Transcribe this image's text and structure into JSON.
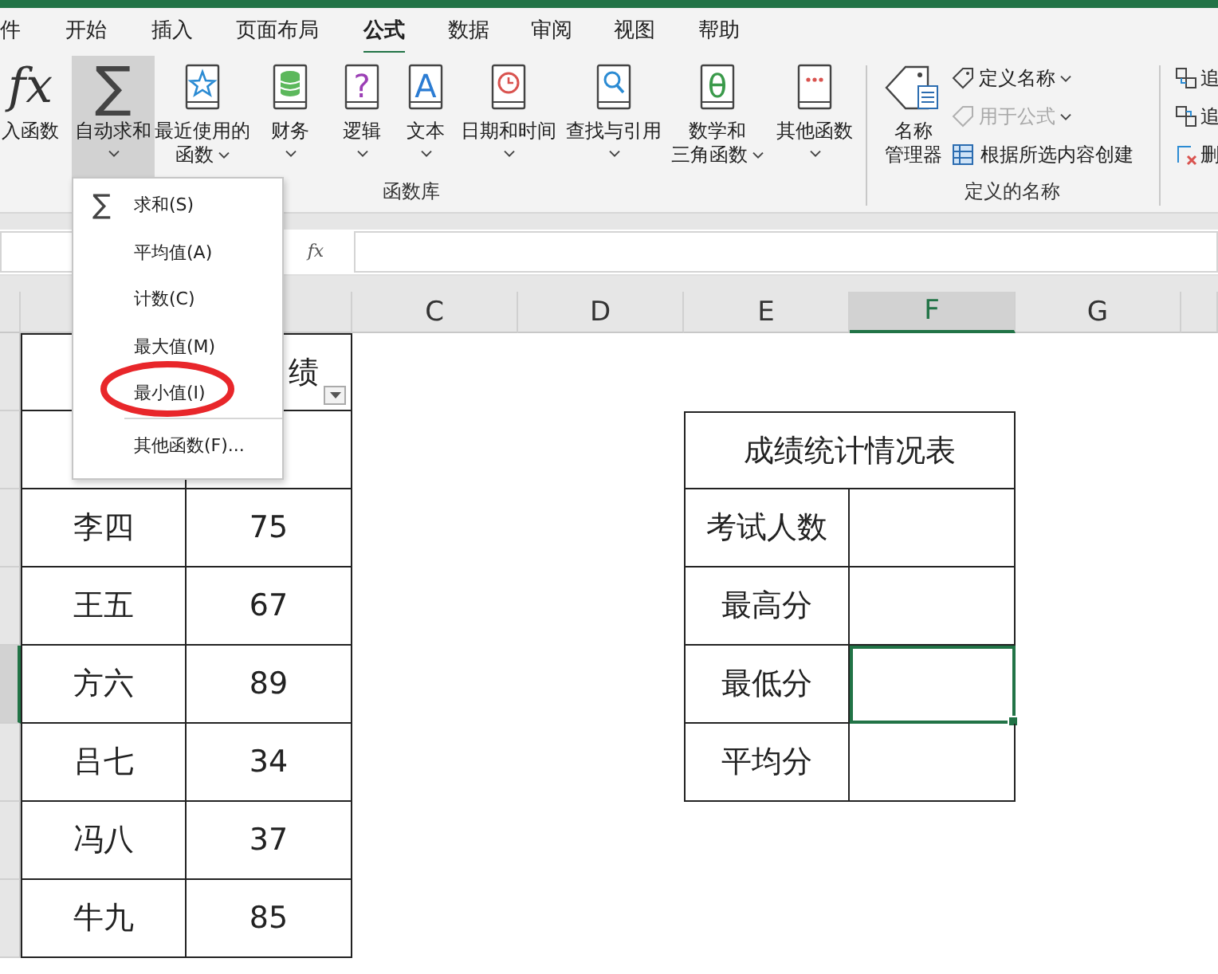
{
  "tabs": [
    {
      "label": "件",
      "selected": false
    },
    {
      "label": "开始",
      "selected": false
    },
    {
      "label": "插入",
      "selected": false
    },
    {
      "label": "页面布局",
      "selected": false
    },
    {
      "label": "公式",
      "selected": true
    },
    {
      "label": "数据",
      "selected": false
    },
    {
      "label": "审阅",
      "selected": false
    },
    {
      "label": "视图",
      "selected": false
    },
    {
      "label": "帮助",
      "selected": false
    }
  ],
  "function_library": {
    "label": "函数库",
    "buttons": [
      {
        "lines": [
          "入函数"
        ],
        "glyph": "fx",
        "dropdown": false,
        "selected": false
      },
      {
        "lines": [
          "自动求和"
        ],
        "glyph": "∑",
        "dropdown": true,
        "selected": true
      },
      {
        "lines": [
          "最近使用的",
          "函数"
        ],
        "dropdown": true,
        "selected": false
      },
      {
        "lines": [
          "财务"
        ],
        "dropdown": true,
        "selected": false
      },
      {
        "lines": [
          "逻辑"
        ],
        "glyph": "?",
        "dropdown": true,
        "selected": false
      },
      {
        "lines": [
          "文本"
        ],
        "glyph": "A",
        "dropdown": true,
        "selected": false
      },
      {
        "lines": [
          "日期和时间"
        ],
        "dropdown": true,
        "selected": false
      },
      {
        "lines": [
          "查找与引用"
        ],
        "dropdown": true,
        "selected": false
      },
      {
        "lines": [
          "数学和",
          "三角函数"
        ],
        "glyph": "θ",
        "dropdown": true,
        "selected": false
      },
      {
        "lines": [
          "其他函数"
        ],
        "dropdown": true,
        "selected": false
      }
    ]
  },
  "defined_names": {
    "label": "定义的名称",
    "manager": {
      "lines": [
        "名称",
        "管理器"
      ]
    },
    "items": [
      {
        "label": "定义名称",
        "dropdown": true,
        "disabled": false
      },
      {
        "label": "用于公式",
        "dropdown": true,
        "disabled": true
      },
      {
        "label": "根据所选内容创建",
        "dropdown": false,
        "disabled": false
      }
    ]
  },
  "formula_auditing": {
    "items": [
      {
        "label": "追"
      },
      {
        "label": "追"
      },
      {
        "label": "删"
      }
    ]
  },
  "autosum_menu": {
    "items": [
      {
        "kind": "item",
        "label": "求和(S)",
        "glyph": "∑"
      },
      {
        "kind": "item",
        "label": "平均值(A)"
      },
      {
        "kind": "item",
        "label": "计数(C)"
      },
      {
        "kind": "item",
        "label": "最大值(M)"
      },
      {
        "kind": "item",
        "label": "最小值(I)"
      },
      {
        "kind": "separator"
      },
      {
        "kind": "item",
        "label": "其他函数(F)..."
      }
    ]
  },
  "formula_bar": {
    "function_label": "fx"
  },
  "sheet": {
    "columns": [
      {
        "label": "C",
        "selected": false
      },
      {
        "label": "D",
        "selected": false
      },
      {
        "label": "E",
        "selected": false
      },
      {
        "label": "F",
        "selected": true
      },
      {
        "label": "G",
        "selected": false
      }
    ],
    "score_header": "绩",
    "score_rows": [
      {
        "name": "李四",
        "score": "75"
      },
      {
        "name": "王五",
        "score": "67"
      },
      {
        "name": "方六",
        "score": "89"
      },
      {
        "name": "吕七",
        "score": "34"
      },
      {
        "name": "冯八",
        "score": "37"
      },
      {
        "name": "牛九",
        "score": "85"
      }
    ],
    "stats_title": "成绩统计情况表",
    "stats_rows": [
      {
        "label": "考试人数",
        "selected": false
      },
      {
        "label": "最高分",
        "selected": false
      },
      {
        "label": "最低分",
        "selected": true
      },
      {
        "label": "平均分",
        "selected": false
      }
    ]
  }
}
